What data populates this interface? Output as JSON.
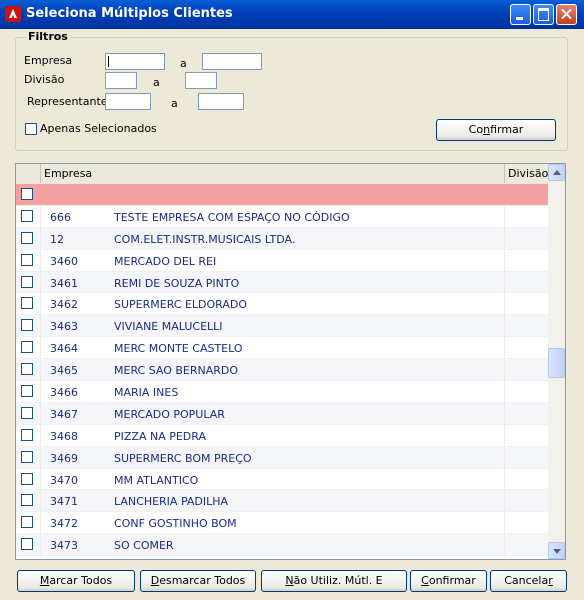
{
  "window": {
    "title": "Seleciona Múltiplos Clientes",
    "accent": "#0040b8"
  },
  "filters": {
    "group_title": "Filtros",
    "empresa_label": "Empresa",
    "divisao_label": "Divisão",
    "representante_label": "Representante",
    "a_label": "a",
    "apenas_label": "Apenas Selecionados",
    "confirm_label": "Confirmar",
    "empresa_from": "",
    "empresa_to": "",
    "divisao_from": "",
    "divisao_to": "",
    "rep_from": "",
    "rep_to": ""
  },
  "grid": {
    "col_empresa": "Empresa",
    "col_divisao": "Divisão",
    "new_row_color": "#f4a0a0",
    "rows": [
      {
        "code": "666",
        "name": "TESTE EMPRESA COM ESPAÇO NO CÓDIGO"
      },
      {
        "code": "12",
        "name": "COM.ELET.INSTR.MUSICAIS LTDA."
      },
      {
        "code": "3460",
        "name": "MERCADO DEL REI"
      },
      {
        "code": "3461",
        "name": "REMI DE SOUZA PINTO"
      },
      {
        "code": "3462",
        "name": "SUPERMERC ELDORADO"
      },
      {
        "code": "3463",
        "name": "VIVIANE MALUCELLI"
      },
      {
        "code": "3464",
        "name": "MERC MONTE CASTELO"
      },
      {
        "code": "3465",
        "name": "MERC SAO BERNARDO"
      },
      {
        "code": "3466",
        "name": "MARIA INES"
      },
      {
        "code": "3467",
        "name": "MERCADO POPULAR"
      },
      {
        "code": "3468",
        "name": "PIZZA NA PEDRA"
      },
      {
        "code": "3469",
        "name": "SUPERMERC BOM PREÇO"
      },
      {
        "code": "3470",
        "name": "MM ATLANTICO"
      },
      {
        "code": "3471",
        "name": "LANCHERIA PADILHA"
      },
      {
        "code": "3472",
        "name": "CONF GOSTINHO BOM"
      },
      {
        "code": "3473",
        "name": "SO COMER"
      }
    ]
  },
  "buttons": {
    "marcar_todos": "Marcar Todos",
    "desmarcar_todos": "Desmarcar Todos",
    "nao_utiliz": "Não Utiliz. Mútl. E",
    "confirmar": "Confirmar",
    "cancelar": "Cancelar"
  }
}
